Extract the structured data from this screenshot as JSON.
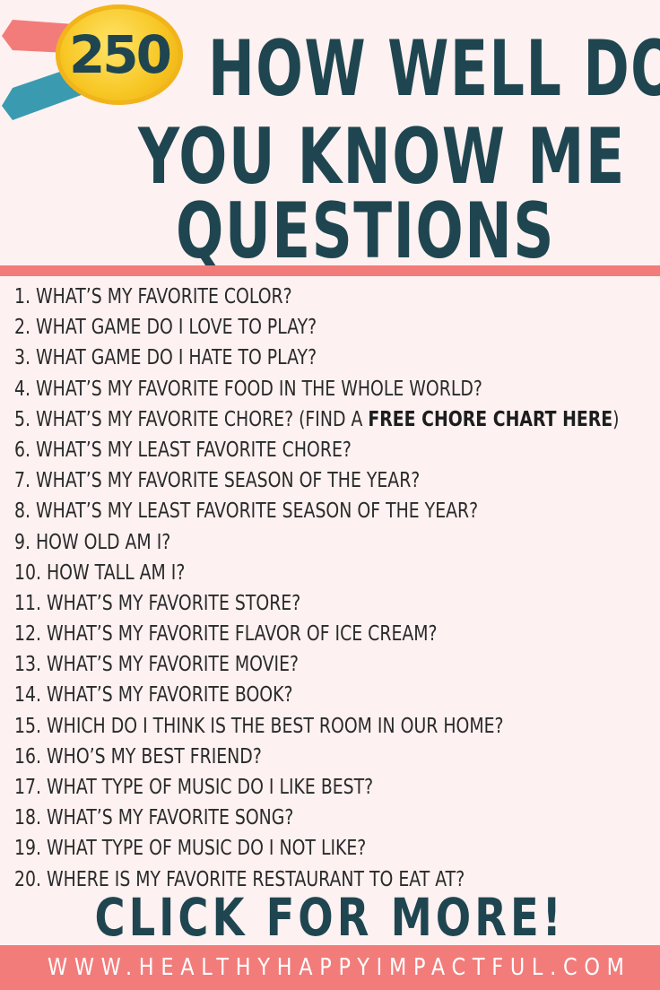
{
  "badge": {
    "number": "250"
  },
  "title": {
    "line1": "HOW WELL DO",
    "line2": "YOU KNOW ME",
    "line3": "QUESTIONS"
  },
  "questions": [
    {
      "text": "1. WHAT’S MY FAVORITE COLOR?"
    },
    {
      "text": "2. WHAT GAME DO I LOVE TO PLAY?"
    },
    {
      "text": "3. WHAT GAME DO I HATE TO PLAY?"
    },
    {
      "text": "4. WHAT’S MY FAVORITE FOOD IN THE WHOLE WORLD?"
    },
    {
      "text": "5. WHAT’S MY FAVORITE CHORE? (FIND A ",
      "bold": "FREE CHORE CHART HERE",
      "after": ")"
    },
    {
      "text": "6. WHAT’S MY LEAST FAVORITE CHORE?"
    },
    {
      "text": "7. WHAT’S MY FAVORITE SEASON OF THE YEAR?"
    },
    {
      "text": "8. WHAT’S MY LEAST FAVORITE SEASON OF THE YEAR?"
    },
    {
      "text": "9. HOW OLD AM I?"
    },
    {
      "text": "10. HOW TALL AM I?"
    },
    {
      "text": "11. WHAT’S MY FAVORITE STORE?"
    },
    {
      "text": "12. WHAT’S MY FAVORITE FLAVOR OF ICE CREAM?"
    },
    {
      "text": "13. WHAT’S MY FAVORITE MOVIE?"
    },
    {
      "text": "14. WHAT’S MY FAVORITE BOOK?"
    },
    {
      "text": "15. WHICH DO I THINK IS THE BEST ROOM IN OUR HOME?"
    },
    {
      "text": "16. WHO’S MY BEST FRIEND?"
    },
    {
      "text": "17. WHAT TYPE OF MUSIC DO I LIKE BEST?"
    },
    {
      "text": "18. WHAT’S MY FAVORITE SONG?"
    },
    {
      "text": "19. WHAT TYPE OF MUSIC DO I NOT LIKE?"
    },
    {
      "text": "20. WHERE IS MY FAVORITE RESTAURANT TO EAT AT?"
    }
  ],
  "cta": {
    "label": "CLICK FOR MORE!"
  },
  "footer": {
    "url": "WWW.HEALTHYHAPPYIMPACTFUL.COM"
  },
  "colors": {
    "background": "#fdf1f1",
    "title": "#1f4650",
    "accent": "#f27c7a",
    "ribbon_teal": "#3a9bb0",
    "medal_gold": "#f7c623"
  }
}
